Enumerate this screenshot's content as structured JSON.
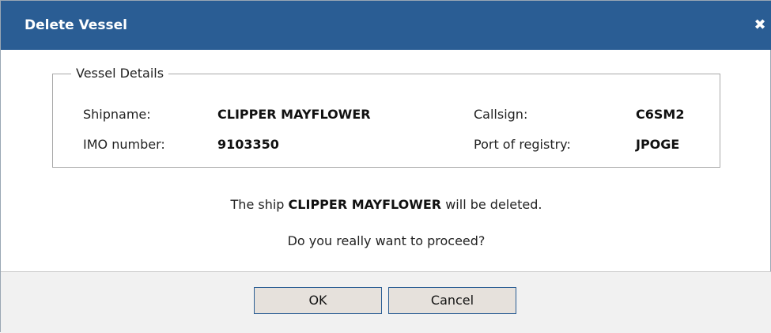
{
  "dialog": {
    "title": "Delete Vessel",
    "close_icon": "close-icon",
    "close_glyph": "✖"
  },
  "vessel_details": {
    "legend": "Vessel Details",
    "shipname_label": "Shipname:",
    "shipname_value": "CLIPPER MAYFLOWER",
    "imo_label": "IMO number:",
    "imo_value": "9103350",
    "callsign_label": "Callsign:",
    "callsign_value": "C6SM2",
    "port_label": "Port of registry:",
    "port_value": "JPOGE"
  },
  "message": {
    "prefix": "The ship ",
    "ship_name": "CLIPPER MAYFLOWER",
    "suffix": " will be deleted.",
    "question": "Do you really want to proceed?"
  },
  "buttons": {
    "ok_label": "OK",
    "cancel_label": "Cancel"
  },
  "colors": {
    "titlebar": "#2a5d94",
    "button_border": "#2a5d94",
    "button_bg": "#e6e1dc",
    "footer_bg": "#f1f1f1"
  }
}
